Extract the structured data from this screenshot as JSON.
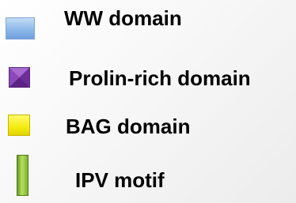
{
  "legend": {
    "items": [
      {
        "label": "WW domain",
        "swatch_color": "#9dc3ef",
        "swatch_shape": "square"
      },
      {
        "label": "Prolin-rich domain",
        "swatch_color": "#8e4ab8",
        "swatch_shape": "square-with-x"
      },
      {
        "label": "BAG domain",
        "swatch_color": "#f2ec1a",
        "swatch_shape": "square"
      },
      {
        "label": "IPV motif",
        "swatch_color": "#8fc13a",
        "swatch_shape": "tall-bar"
      }
    ]
  }
}
